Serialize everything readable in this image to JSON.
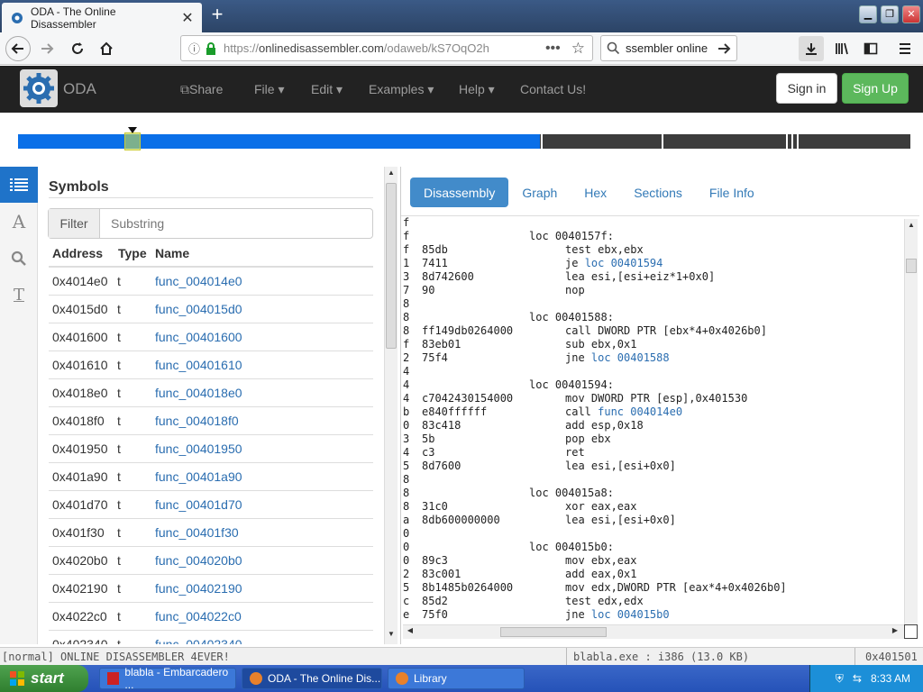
{
  "browser": {
    "tab_title": "ODA - The Online Disassembler",
    "url_prefix": "https://",
    "url_host": "onlinedisassembler.com",
    "url_path": "/odaweb/kS7OqO2h",
    "search_text": "ssembler online"
  },
  "site": {
    "brand": "ODA",
    "menu": [
      "Share",
      "File",
      "Edit",
      "Examples",
      "Help",
      "Contact Us!"
    ],
    "signin": "Sign in",
    "signup": "Sign Up"
  },
  "navigator": {
    "position_fraction": 0.585
  },
  "symbols": {
    "title": "Symbols",
    "filter_label": "Filter",
    "filter_placeholder": "Substring",
    "headers": [
      "Address",
      "Type",
      "Name"
    ],
    "rows": [
      [
        "0x4014e0",
        "t",
        "func_004014e0"
      ],
      [
        "0x4015d0",
        "t",
        "func_004015d0"
      ],
      [
        "0x401600",
        "t",
        "func_00401600"
      ],
      [
        "0x401610",
        "t",
        "func_00401610"
      ],
      [
        "0x4018e0",
        "t",
        "func_004018e0"
      ],
      [
        "0x4018f0",
        "t",
        "func_004018f0"
      ],
      [
        "0x401950",
        "t",
        "func_00401950"
      ],
      [
        "0x401a90",
        "t",
        "func_00401a90"
      ],
      [
        "0x401d70",
        "t",
        "func_00401d70"
      ],
      [
        "0x401f30",
        "t",
        "func_00401f30"
      ],
      [
        "0x4020b0",
        "t",
        "func_004020b0"
      ],
      [
        "0x402190",
        "t",
        "func_00402190"
      ],
      [
        "0x4022c0",
        "t",
        "func_004022c0"
      ],
      [
        "0x402340",
        "t",
        "func_00402340"
      ]
    ]
  },
  "tabs": [
    "Disassembly",
    "Graph",
    "Hex",
    "Sections",
    "File Info"
  ],
  "code": [
    {
      "m": "f",
      "b": "",
      "label": "",
      "op": "",
      "arg": "",
      "link": ""
    },
    {
      "m": "f",
      "b": "",
      "label": "loc 0040157f:",
      "op": "",
      "arg": "",
      "link": ""
    },
    {
      "m": "f",
      "b": "85db",
      "label": "",
      "op": "test ebx,ebx",
      "arg": "",
      "link": ""
    },
    {
      "m": "1",
      "b": "7411",
      "label": "",
      "op": "je ",
      "arg": "",
      "link": "loc 00401594"
    },
    {
      "m": "3",
      "b": "8d742600",
      "label": "",
      "op": "lea esi,[esi+eiz*1+0x0]",
      "arg": "",
      "link": ""
    },
    {
      "m": "7",
      "b": "90",
      "label": "",
      "op": "nop",
      "arg": "",
      "link": ""
    },
    {
      "m": "8",
      "b": "",
      "label": "",
      "op": "",
      "arg": "",
      "link": ""
    },
    {
      "m": "8",
      "b": "",
      "label": "loc 00401588:",
      "op": "",
      "arg": "",
      "link": ""
    },
    {
      "m": "8",
      "b": "ff149db0264000",
      "label": "",
      "op": "call DWORD PTR [ebx*4+0x4026b0]",
      "arg": "",
      "link": ""
    },
    {
      "m": "f",
      "b": "83eb01",
      "label": "",
      "op": "sub ebx,0x1",
      "arg": "",
      "link": ""
    },
    {
      "m": "2",
      "b": "75f4",
      "label": "",
      "op": "jne ",
      "arg": "",
      "link": "loc 00401588"
    },
    {
      "m": "4",
      "b": "",
      "label": "",
      "op": "",
      "arg": "",
      "link": ""
    },
    {
      "m": "4",
      "b": "",
      "label": "loc 00401594:",
      "op": "",
      "arg": "",
      "link": ""
    },
    {
      "m": "4",
      "b": "c7042430154000",
      "label": "",
      "op": "mov DWORD PTR [esp],0x401530",
      "arg": "",
      "link": ""
    },
    {
      "m": "b",
      "b": "e840ffffff",
      "label": "",
      "op": "call ",
      "arg": "",
      "link": "func 004014e0"
    },
    {
      "m": "0",
      "b": "83c418",
      "label": "",
      "op": "add esp,0x18",
      "arg": "",
      "link": ""
    },
    {
      "m": "3",
      "b": "5b",
      "label": "",
      "op": "pop ebx",
      "arg": "",
      "link": ""
    },
    {
      "m": "4",
      "b": "c3",
      "label": "",
      "op": "ret",
      "arg": "",
      "link": ""
    },
    {
      "m": "5",
      "b": "8d7600",
      "label": "",
      "op": "lea esi,[esi+0x0]",
      "arg": "",
      "link": ""
    },
    {
      "m": "8",
      "b": "",
      "label": "",
      "op": "",
      "arg": "",
      "link": ""
    },
    {
      "m": "8",
      "b": "",
      "label": "loc 004015a8:",
      "op": "",
      "arg": "",
      "link": ""
    },
    {
      "m": "8",
      "b": "31c0",
      "label": "",
      "op": "xor eax,eax",
      "arg": "",
      "link": ""
    },
    {
      "m": "a",
      "b": "8db600000000",
      "label": "",
      "op": "lea esi,[esi+0x0]",
      "arg": "",
      "link": ""
    },
    {
      "m": "0",
      "b": "",
      "label": "",
      "op": "",
      "arg": "",
      "link": ""
    },
    {
      "m": "0",
      "b": "",
      "label": "loc 004015b0:",
      "op": "",
      "arg": "",
      "link": ""
    },
    {
      "m": "0",
      "b": "89c3",
      "label": "",
      "op": "mov ebx,eax",
      "arg": "",
      "link": ""
    },
    {
      "m": "2",
      "b": "83c001",
      "label": "",
      "op": "add eax,0x1",
      "arg": "",
      "link": ""
    },
    {
      "m": "5",
      "b": "8b1485b0264000",
      "label": "",
      "op": "mov edx,DWORD PTR [eax*4+0x4026b0]",
      "arg": "",
      "link": ""
    },
    {
      "m": "c",
      "b": "85d2",
      "label": "",
      "op": "test edx,edx",
      "arg": "",
      "link": ""
    },
    {
      "m": "e",
      "b": "75f0",
      "label": "",
      "op": "jne ",
      "arg": "",
      "link": "loc 004015b0"
    }
  ],
  "status": {
    "mode": "[normal] ONLINE DISASSEMBLER 4EVER!",
    "file": "blabla.exe : i386 (13.0 KB)",
    "addr": "0x401501"
  },
  "taskbar": {
    "start": "start",
    "tasks": [
      "blabla - Embarcadero ...",
      "ODA - The Online Dis...",
      "Library"
    ],
    "clock": "8:33 AM"
  },
  "colors": {
    "accent": "#428bca",
    "brand_green": "#5cb85c",
    "nav_blue": "#0a6fe8"
  }
}
